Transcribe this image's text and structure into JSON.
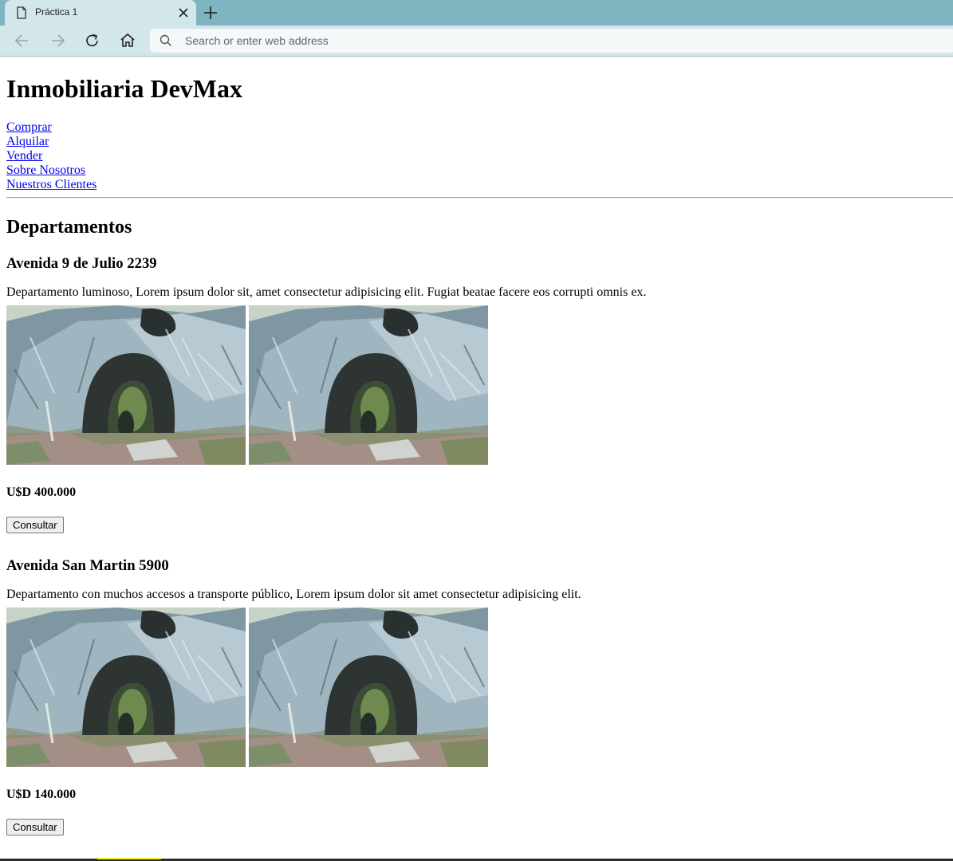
{
  "browser": {
    "tab_title": "Práctica 1",
    "url_placeholder": "Search or enter web address",
    "icons": [
      "page-icon",
      "close-icon",
      "plus-icon",
      "back-icon",
      "forward-icon",
      "reload-icon",
      "home-icon",
      "search-icon"
    ]
  },
  "site": {
    "title": "Inmobiliaria DevMax",
    "nav": [
      "Comprar",
      "Alquilar",
      "Vender",
      "Sobre Nosotros",
      "Nuestros Clientes"
    ]
  },
  "section": {
    "title": "Departamentos",
    "listings": [
      {
        "address": "Avenida 9 de Julio 2239",
        "description": "Departamento luminoso, Lorem ipsum dolor sit, amet consectetur adipisicing elit. Fugiat beatae facere eos corrupti omnis ex.",
        "price": "U$D 400.000",
        "button": "Consultar"
      },
      {
        "address": "Avenida San Martin 5900",
        "description": "Departamento con muchos accesos a transporte público, Lorem ipsum dolor sit amet consectetur adipisicing elit.",
        "price": "U$D 140.000",
        "button": "Consultar"
      }
    ]
  },
  "colors": {
    "tabbar": "#7fb5c0",
    "toolbar": "#d3e6ea",
    "link": "#0000ee"
  }
}
